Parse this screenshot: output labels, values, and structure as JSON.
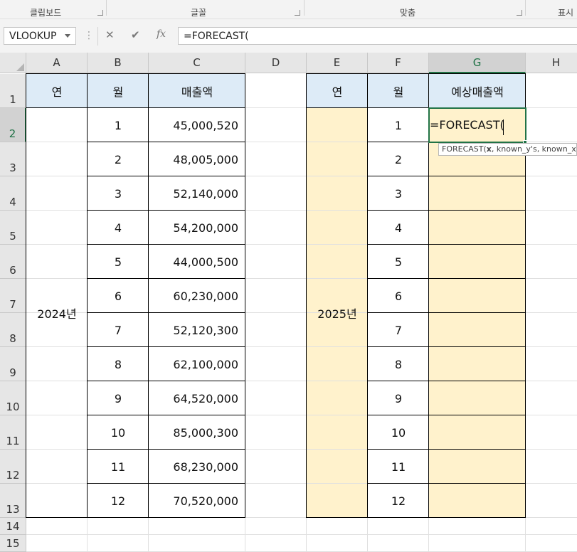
{
  "ribbon": {
    "groups": [
      {
        "label": "클립보드"
      },
      {
        "label": "글꼴"
      },
      {
        "label": "맞춤"
      },
      {
        "label": "표시"
      }
    ]
  },
  "formula_bar": {
    "name_box": "VLOOKUP",
    "cancel_icon": "✕",
    "enter_icon": "✔",
    "fx_icon": "fx",
    "formula": "=FORECAST("
  },
  "columns": [
    "A",
    "B",
    "C",
    "D",
    "E",
    "F",
    "G",
    "H"
  ],
  "rows": [
    "1",
    "2",
    "3",
    "4",
    "5",
    "6",
    "7",
    "8",
    "9",
    "10",
    "11",
    "12",
    "13",
    "14",
    "15"
  ],
  "selected": {
    "column": "G",
    "row": "2"
  },
  "left_table": {
    "headers": {
      "year": "연",
      "month": "월",
      "sales": "매출액"
    },
    "year_label": "2024년",
    "months": [
      "1",
      "2",
      "3",
      "4",
      "5",
      "6",
      "7",
      "8",
      "9",
      "10",
      "11",
      "12"
    ],
    "sales": [
      "45,000,520",
      "48,005,000",
      "52,140,000",
      "54,200,000",
      "44,000,500",
      "60,230,000",
      "52,120,300",
      "62,100,000",
      "64,520,000",
      "85,000,300",
      "68,230,000",
      "70,520,000"
    ]
  },
  "right_table": {
    "headers": {
      "year": "연",
      "month": "월",
      "forecast": "예상매출액"
    },
    "year_label": "2025년",
    "months": [
      "1",
      "2",
      "3",
      "4",
      "5",
      "6",
      "7",
      "8",
      "9",
      "10",
      "11",
      "12"
    ]
  },
  "editing": {
    "cell_text": "=FORECAST(",
    "tooltip_fn": "FORECAST(",
    "tooltip_arg_bold": "x",
    "tooltip_rest": ", known_y's, known_x's)"
  },
  "colors": {
    "header_fill": "#ddebf7",
    "input_fill": "#fff2cc",
    "accent": "#217346"
  }
}
